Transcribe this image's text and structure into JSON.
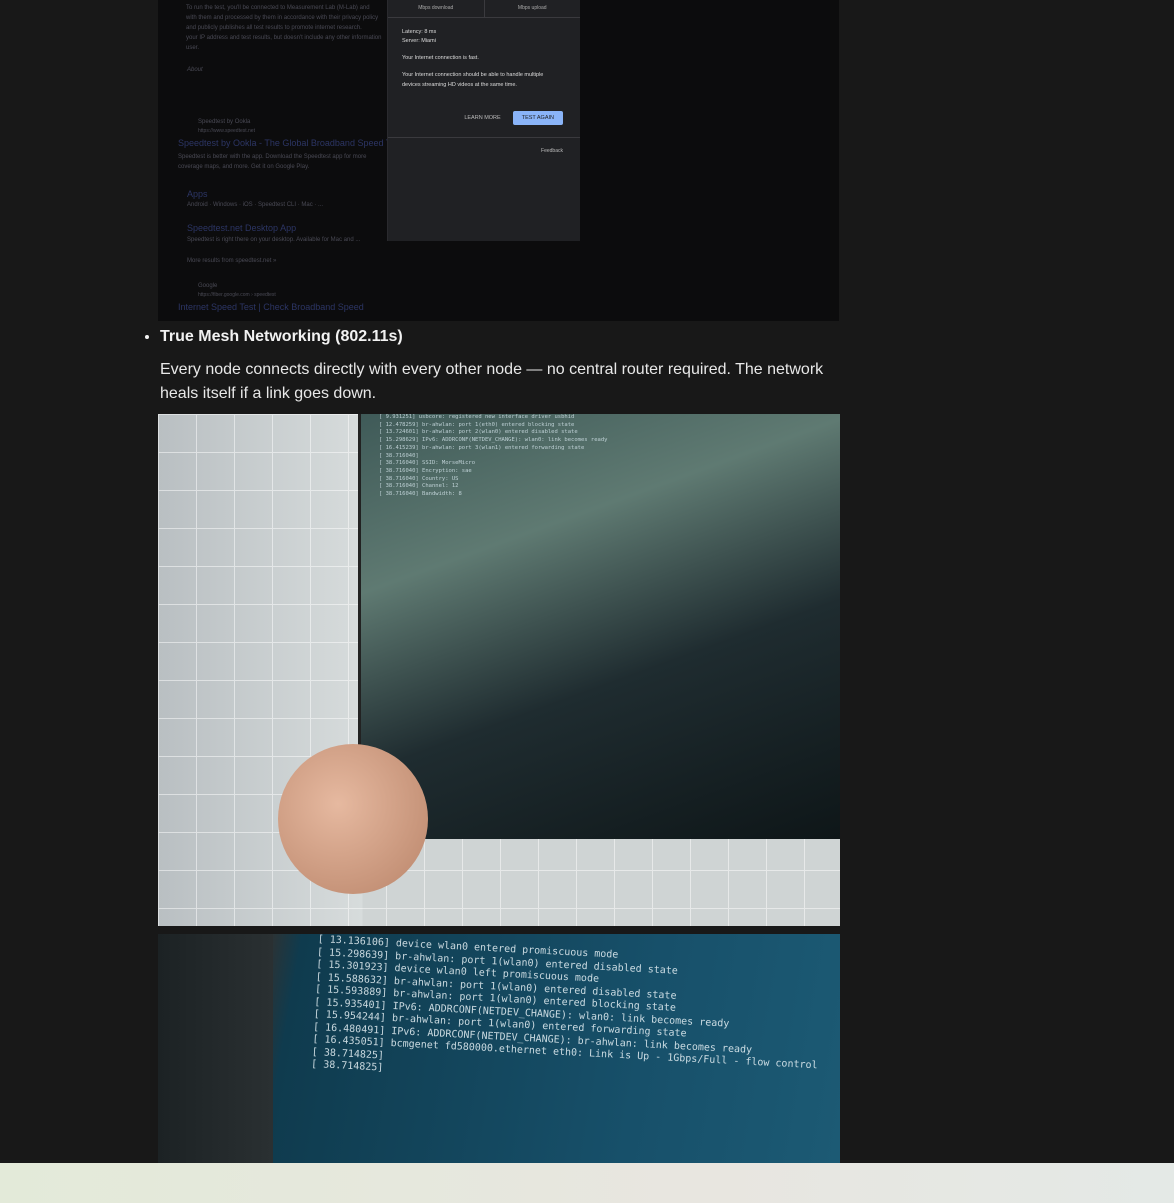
{
  "speedtest_screenshot": {
    "intro_lines": [
      "To run the test, you'll be connected to Measurement Lab (M-Lab) and",
      "with them and processed by them in accordance with their privacy policy",
      "and publicly publishes all test results to promote internet research.",
      "your IP address and test results, but doesn't include any other information",
      "user."
    ],
    "about": "About",
    "result1_site": "Speedtest by Ookla",
    "result1_url": "https://www.speedtest.net",
    "result1_title": "Speedtest by Ookla - The Global Broadband Speed Test",
    "result1_desc": "Speedtest is better with the app. Download the Speedtest app for more coverage maps, and more. Get it on Google Play.",
    "sub1_title": "Apps",
    "sub1_desc": "Android · Windows · iOS · Speedtest CLI · Mac · ...",
    "sub2_title": "Speedtest.net Desktop App",
    "sub2_desc": "Speedtest is right there on your desktop. Available for Mac and ...",
    "more_results": "More results from speedtest.net »",
    "result2_site": "Google",
    "result2_url": "https://fiber.google.com › speedtest",
    "result2_title": "Internet Speed Test | Check Broadband Speed",
    "panel": {
      "download_label": "Mbps download",
      "upload_label": "Mbps upload",
      "latency": "Latency: 8 ms",
      "server": "Server: Miami",
      "verdict": "Your Internet connection is fast.",
      "detail": "Your Internet connection should be able to handle multiple devices streaming HD videos at the same time.",
      "learn_more": "LEARN MORE",
      "test_again": "TEST AGAIN",
      "feedback": "Feedback"
    }
  },
  "feature": {
    "title": "True Mesh Networking (802.11s)",
    "description": "Every node connects directly with every other node — no central router required. The network heals itself if a link goes down."
  },
  "photo1_terminal": "[ 9.931251] usbcore: registered new interface driver usbhid\n[ 12.478259] br-ahwlan: port 1(eth0) entered blocking state\n[ 13.724601] br-ahwlan: port 2(wlan0) entered disabled state\n[ 15.298629] IPv6: ADDRCONF(NETDEV_CHANGE): wlan0: link becomes ready\n[ 16.415239] br-ahwlan: port 3(wlan1) entered forwarding state\n[ 38.716040]\n[ 38.716040] SSID: MorseMicro\n[ 38.716040] Encryption: sae\n[ 38.716040] Country: US\n[ 38.716040] Channel: 12\n[ 38.716040] Bandwidth: 8",
  "photo2_terminal": "[ 13.136106] device wlan0 entered promiscuous mode\n[ 15.298639] br-ahwlan: port 1(wlan0) entered disabled state\n[ 15.301923] device wlan0 left promiscuous mode\n[ 15.588632] br-ahwlan: port 1(wlan0) entered disabled state\n[ 15.593889] br-ahwlan: port 1(wlan0) entered blocking state\n[ 15.935401] IPv6: ADDRCONF(NETDEV_CHANGE): wlan0: link becomes ready\n[ 15.954244] br-ahwlan: port 1(wlan0) entered forwarding state\n[ 16.480491] IPv6: ADDRCONF(NETDEV_CHANGE): br-ahwlan: link becomes ready\n[ 16.435051] bcmgenet fd580000.ethernet eth0: Link is Up - 1Gbps/Full - flow control\n[ 38.714825]\n[ 38.714825]"
}
